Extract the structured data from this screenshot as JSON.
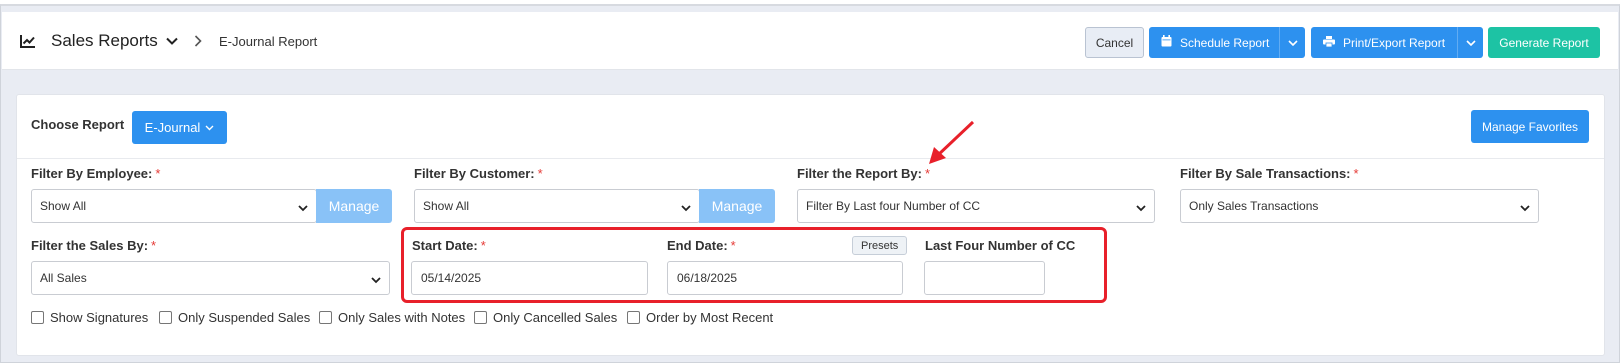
{
  "header": {
    "title": "Sales Reports",
    "breadcrumb_current": "E-Journal Report",
    "buttons": {
      "cancel": "Cancel",
      "schedule": "Schedule Report",
      "print": "Print/Export Report",
      "generate": "Generate Report"
    }
  },
  "report": {
    "choose_label": "Choose Report",
    "selected": "E-Journal",
    "manage_favorites": "Manage Favorites"
  },
  "filters": {
    "employee": {
      "label": "Filter By Employee:",
      "value": "Show All",
      "manage": "Manage"
    },
    "customer": {
      "label": "Filter By Customer:",
      "value": "Show All",
      "manage": "Manage"
    },
    "report_by": {
      "label": "Filter the Report By:",
      "value": "Filter By Last four Number of CC"
    },
    "sale_transactions": {
      "label": "Filter By Sale Transactions:",
      "value": "Only Sales Transactions"
    },
    "sales_by": {
      "label": "Filter the Sales By:",
      "value": "All Sales"
    },
    "start_date": {
      "label": "Start Date:",
      "value": "05/14/2025"
    },
    "end_date": {
      "label": "End Date:",
      "value": "06/18/2025",
      "presets": "Presets"
    },
    "last_four": {
      "label": "Last Four Number of CC",
      "value": ""
    }
  },
  "required_mark": "*",
  "checkboxes": [
    "Show Signatures",
    "Only Suspended Sales",
    "Only Sales with Notes",
    "Only Cancelled Sales",
    "Order by Most Recent"
  ],
  "colors": {
    "primary": "#2d91ef",
    "teal": "#1dc3a4",
    "required": "#e53935",
    "highlight": "#e8202a"
  }
}
